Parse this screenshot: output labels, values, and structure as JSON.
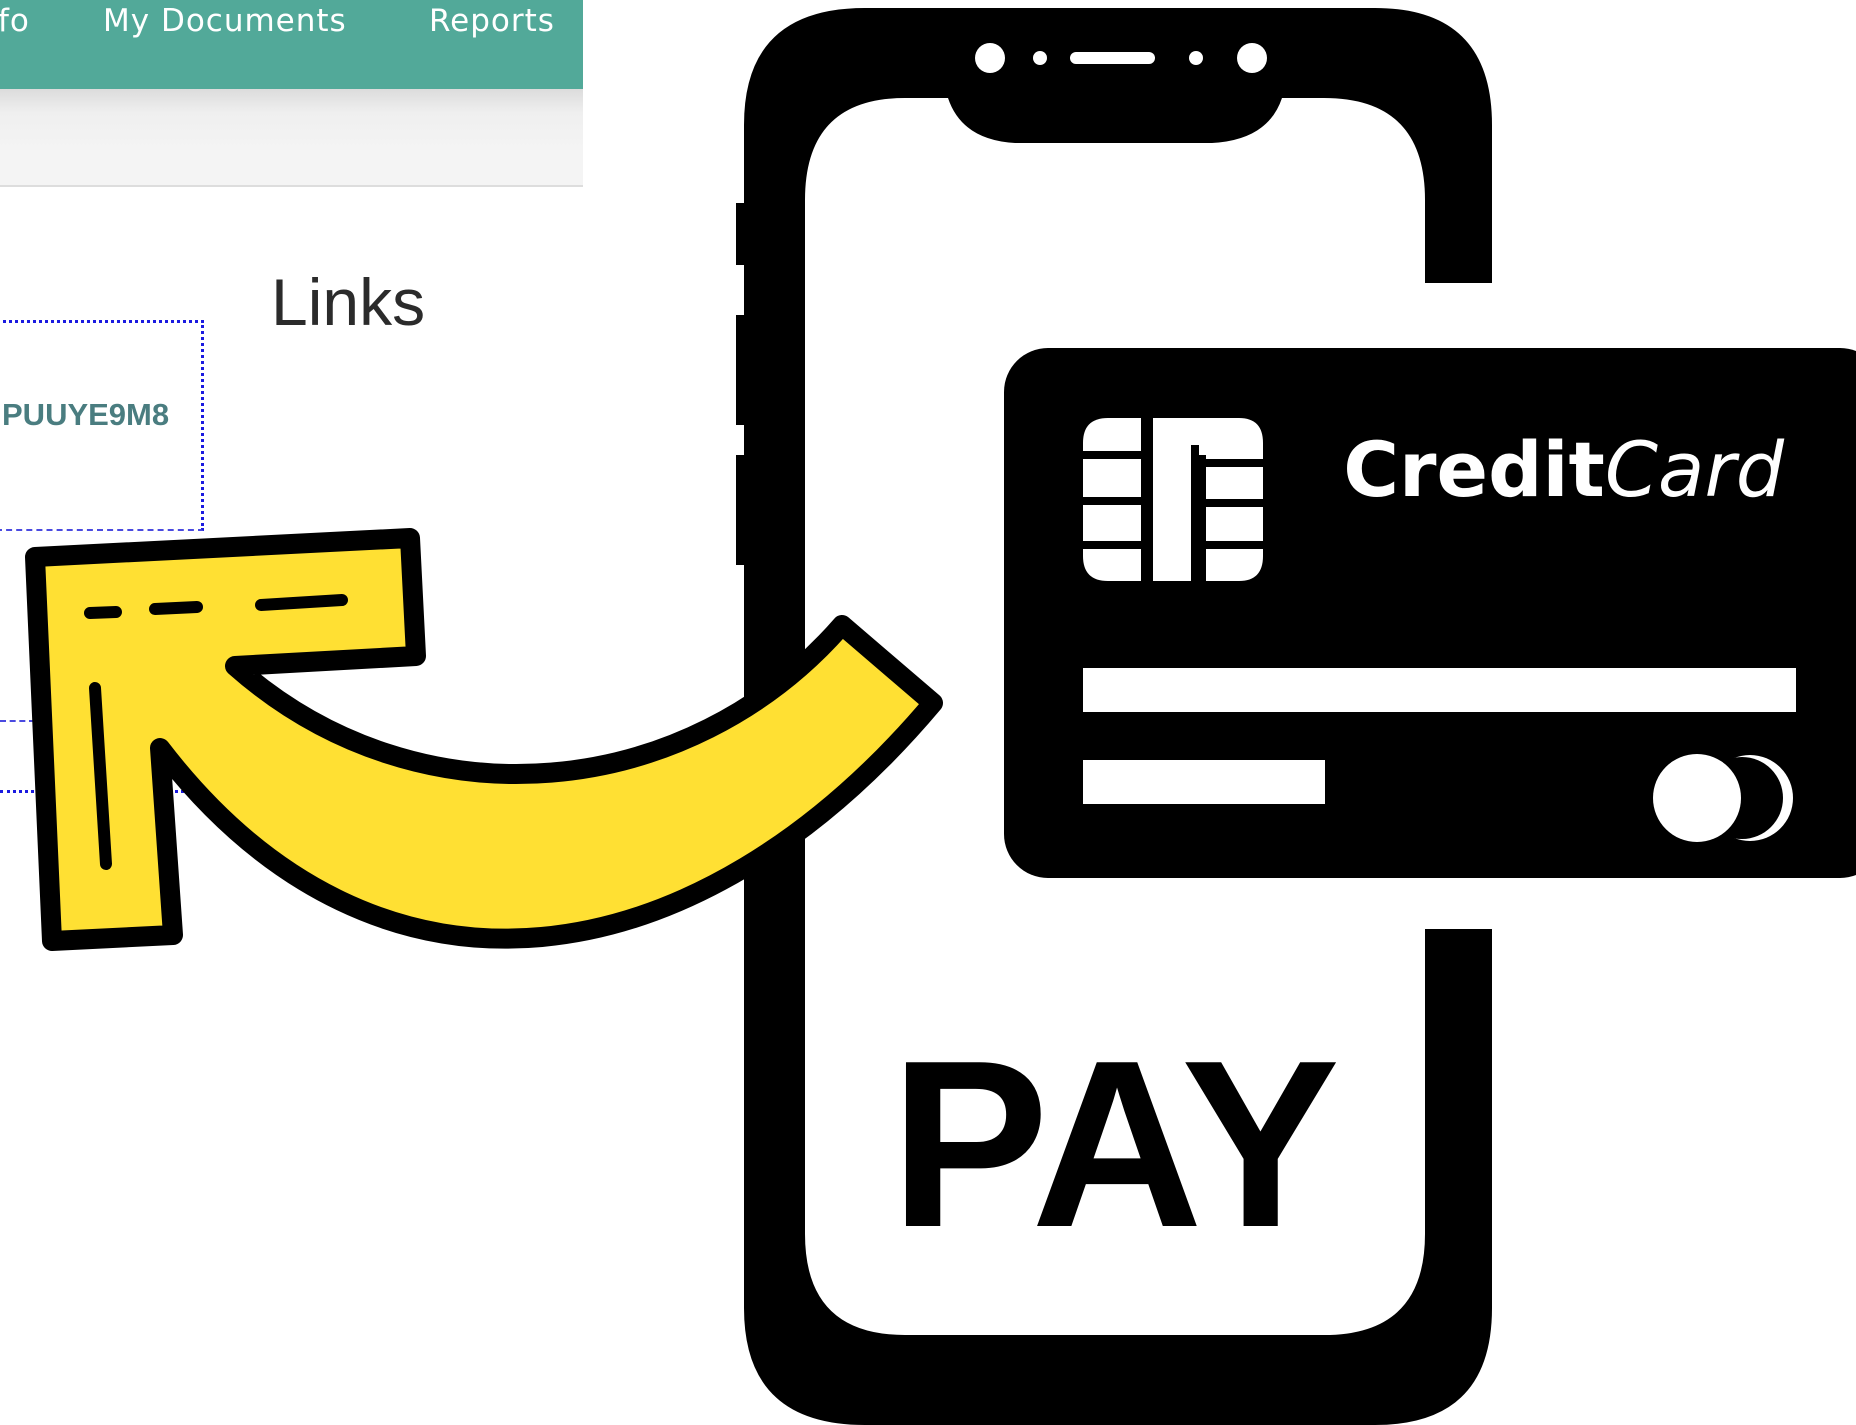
{
  "nav": {
    "items": [
      {
        "label": "fo"
      },
      {
        "label": "My Documents"
      },
      {
        "label": "Reports"
      }
    ],
    "bar_color": "#52a999"
  },
  "content": {
    "heading": "Links",
    "code": "PUUYE9M8"
  },
  "card": {
    "brand_bold": "Credit",
    "brand_italic": "Card"
  },
  "phone": {
    "pay_label": "PAY"
  },
  "colors": {
    "arrow_fill": "#ffe033",
    "icon_black": "#000000",
    "link_border": "#1a1ae0"
  },
  "icons": {
    "phone": "smartphone-icon",
    "card": "credit-card-icon",
    "arrow": "curved-arrow-icon"
  }
}
